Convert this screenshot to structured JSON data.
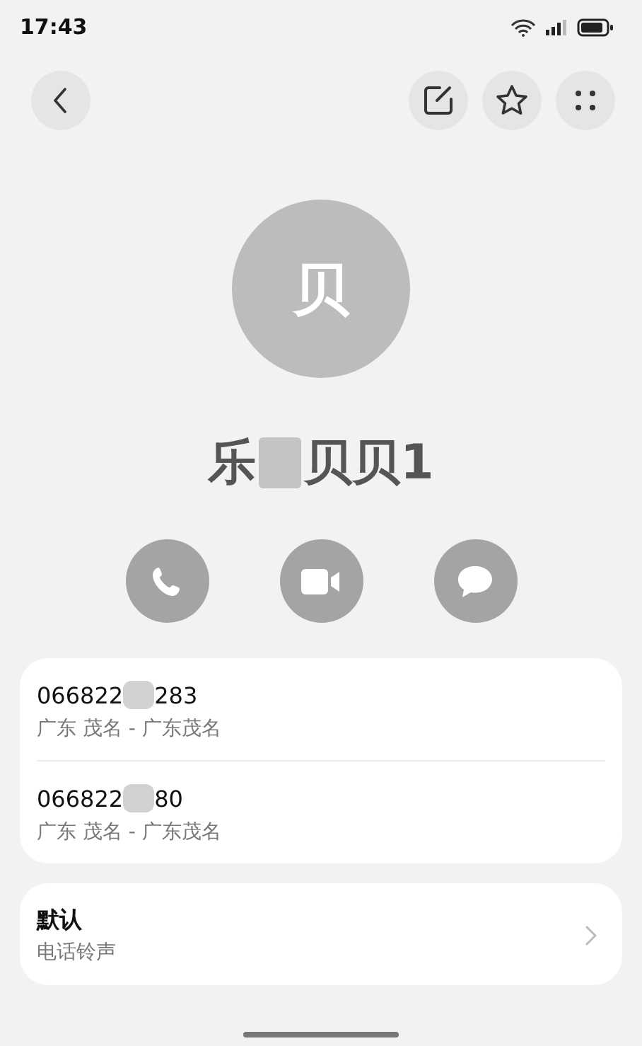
{
  "status_bar": {
    "time": "17:43"
  },
  "avatar": {
    "initial": "贝"
  },
  "name": {
    "start": "乐",
    "end": "贝贝1"
  },
  "numbers": [
    {
      "start": "066822",
      "end": "283",
      "location": "广东 茂名 - 广东茂名"
    },
    {
      "start": "066822",
      "end": "80",
      "location": "广东 茂名 - 广东茂名"
    }
  ],
  "ringtone": {
    "value": "默认",
    "label": "电话铃声"
  }
}
